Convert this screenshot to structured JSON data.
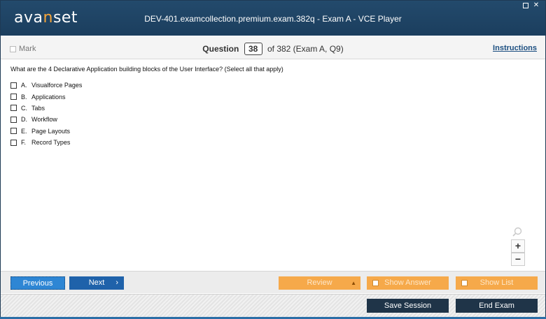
{
  "app": {
    "logo_text_pre": "ava",
    "logo_text_accent": "n",
    "logo_text_post": "set",
    "window_title": "DEV-401.examcollection.premium.exam.382q - Exam A - VCE Player"
  },
  "header": {
    "mark_label": "Mark",
    "question_label": "Question",
    "question_number": "38",
    "question_of": "of 382 (Exam A, Q9)",
    "instructions_label": "Instructions"
  },
  "question": {
    "text": "What are the 4 Declarative Application building blocks of the User Interface? (Select all that apply)",
    "options": [
      {
        "letter": "A.",
        "label": "Visualforce Pages"
      },
      {
        "letter": "B.",
        "label": "Applications"
      },
      {
        "letter": "C.",
        "label": "Tabs"
      },
      {
        "letter": "D.",
        "label": "Workflow"
      },
      {
        "letter": "E.",
        "label": "Page Layouts"
      },
      {
        "letter": "F.",
        "label": "Record Types"
      }
    ]
  },
  "zoom": {
    "in_label": "+",
    "out_label": "−"
  },
  "nav": {
    "previous_label": "Previous",
    "next_label": "Next",
    "review_label": "Review",
    "show_answer_label": "Show Answer",
    "show_list_label": "Show List",
    "save_session_label": "Save Session",
    "end_exam_label": "End Exam"
  },
  "colors": {
    "titlebar": "#1b3e5e",
    "accent": "#f7a539",
    "primary_button": "#1f62aa",
    "orange_button": "#f6a94a",
    "dark_button": "#1f3448"
  }
}
